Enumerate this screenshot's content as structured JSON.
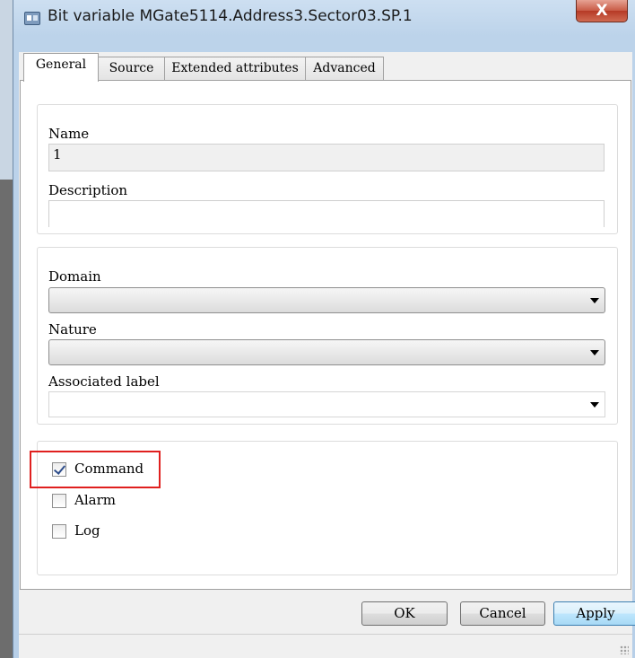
{
  "window": {
    "title": "Bit variable MGate5114.Address3.Sector03.SP.1",
    "close_label": "X"
  },
  "tabs": [
    {
      "label": "General",
      "active": true
    },
    {
      "label": "Source",
      "active": false
    },
    {
      "label": "Extended attributes",
      "active": false
    },
    {
      "label": "Advanced",
      "active": false
    }
  ],
  "general": {
    "name_label": "Name",
    "name_value": "1",
    "description_label": "Description",
    "description_value": "",
    "domain_label": "Domain",
    "domain_value": "",
    "nature_label": "Nature",
    "nature_value": "",
    "associated_label_label": "Associated label",
    "associated_label_value": ""
  },
  "options": [
    {
      "label": "Command",
      "checked": true,
      "highlighted": true
    },
    {
      "label": "Alarm",
      "checked": false
    },
    {
      "label": "Log",
      "checked": false
    }
  ],
  "buttons": {
    "ok": "OK",
    "cancel": "Cancel",
    "apply": "Apply"
  },
  "icons": [
    "app-icon",
    "close-icon",
    "dropdown-arrow-icon",
    "resize-grip-icon"
  ],
  "colors": {
    "highlight_box": "#e0201f",
    "close_button": "#c85a45",
    "title_bar": "#bcd3ea"
  }
}
